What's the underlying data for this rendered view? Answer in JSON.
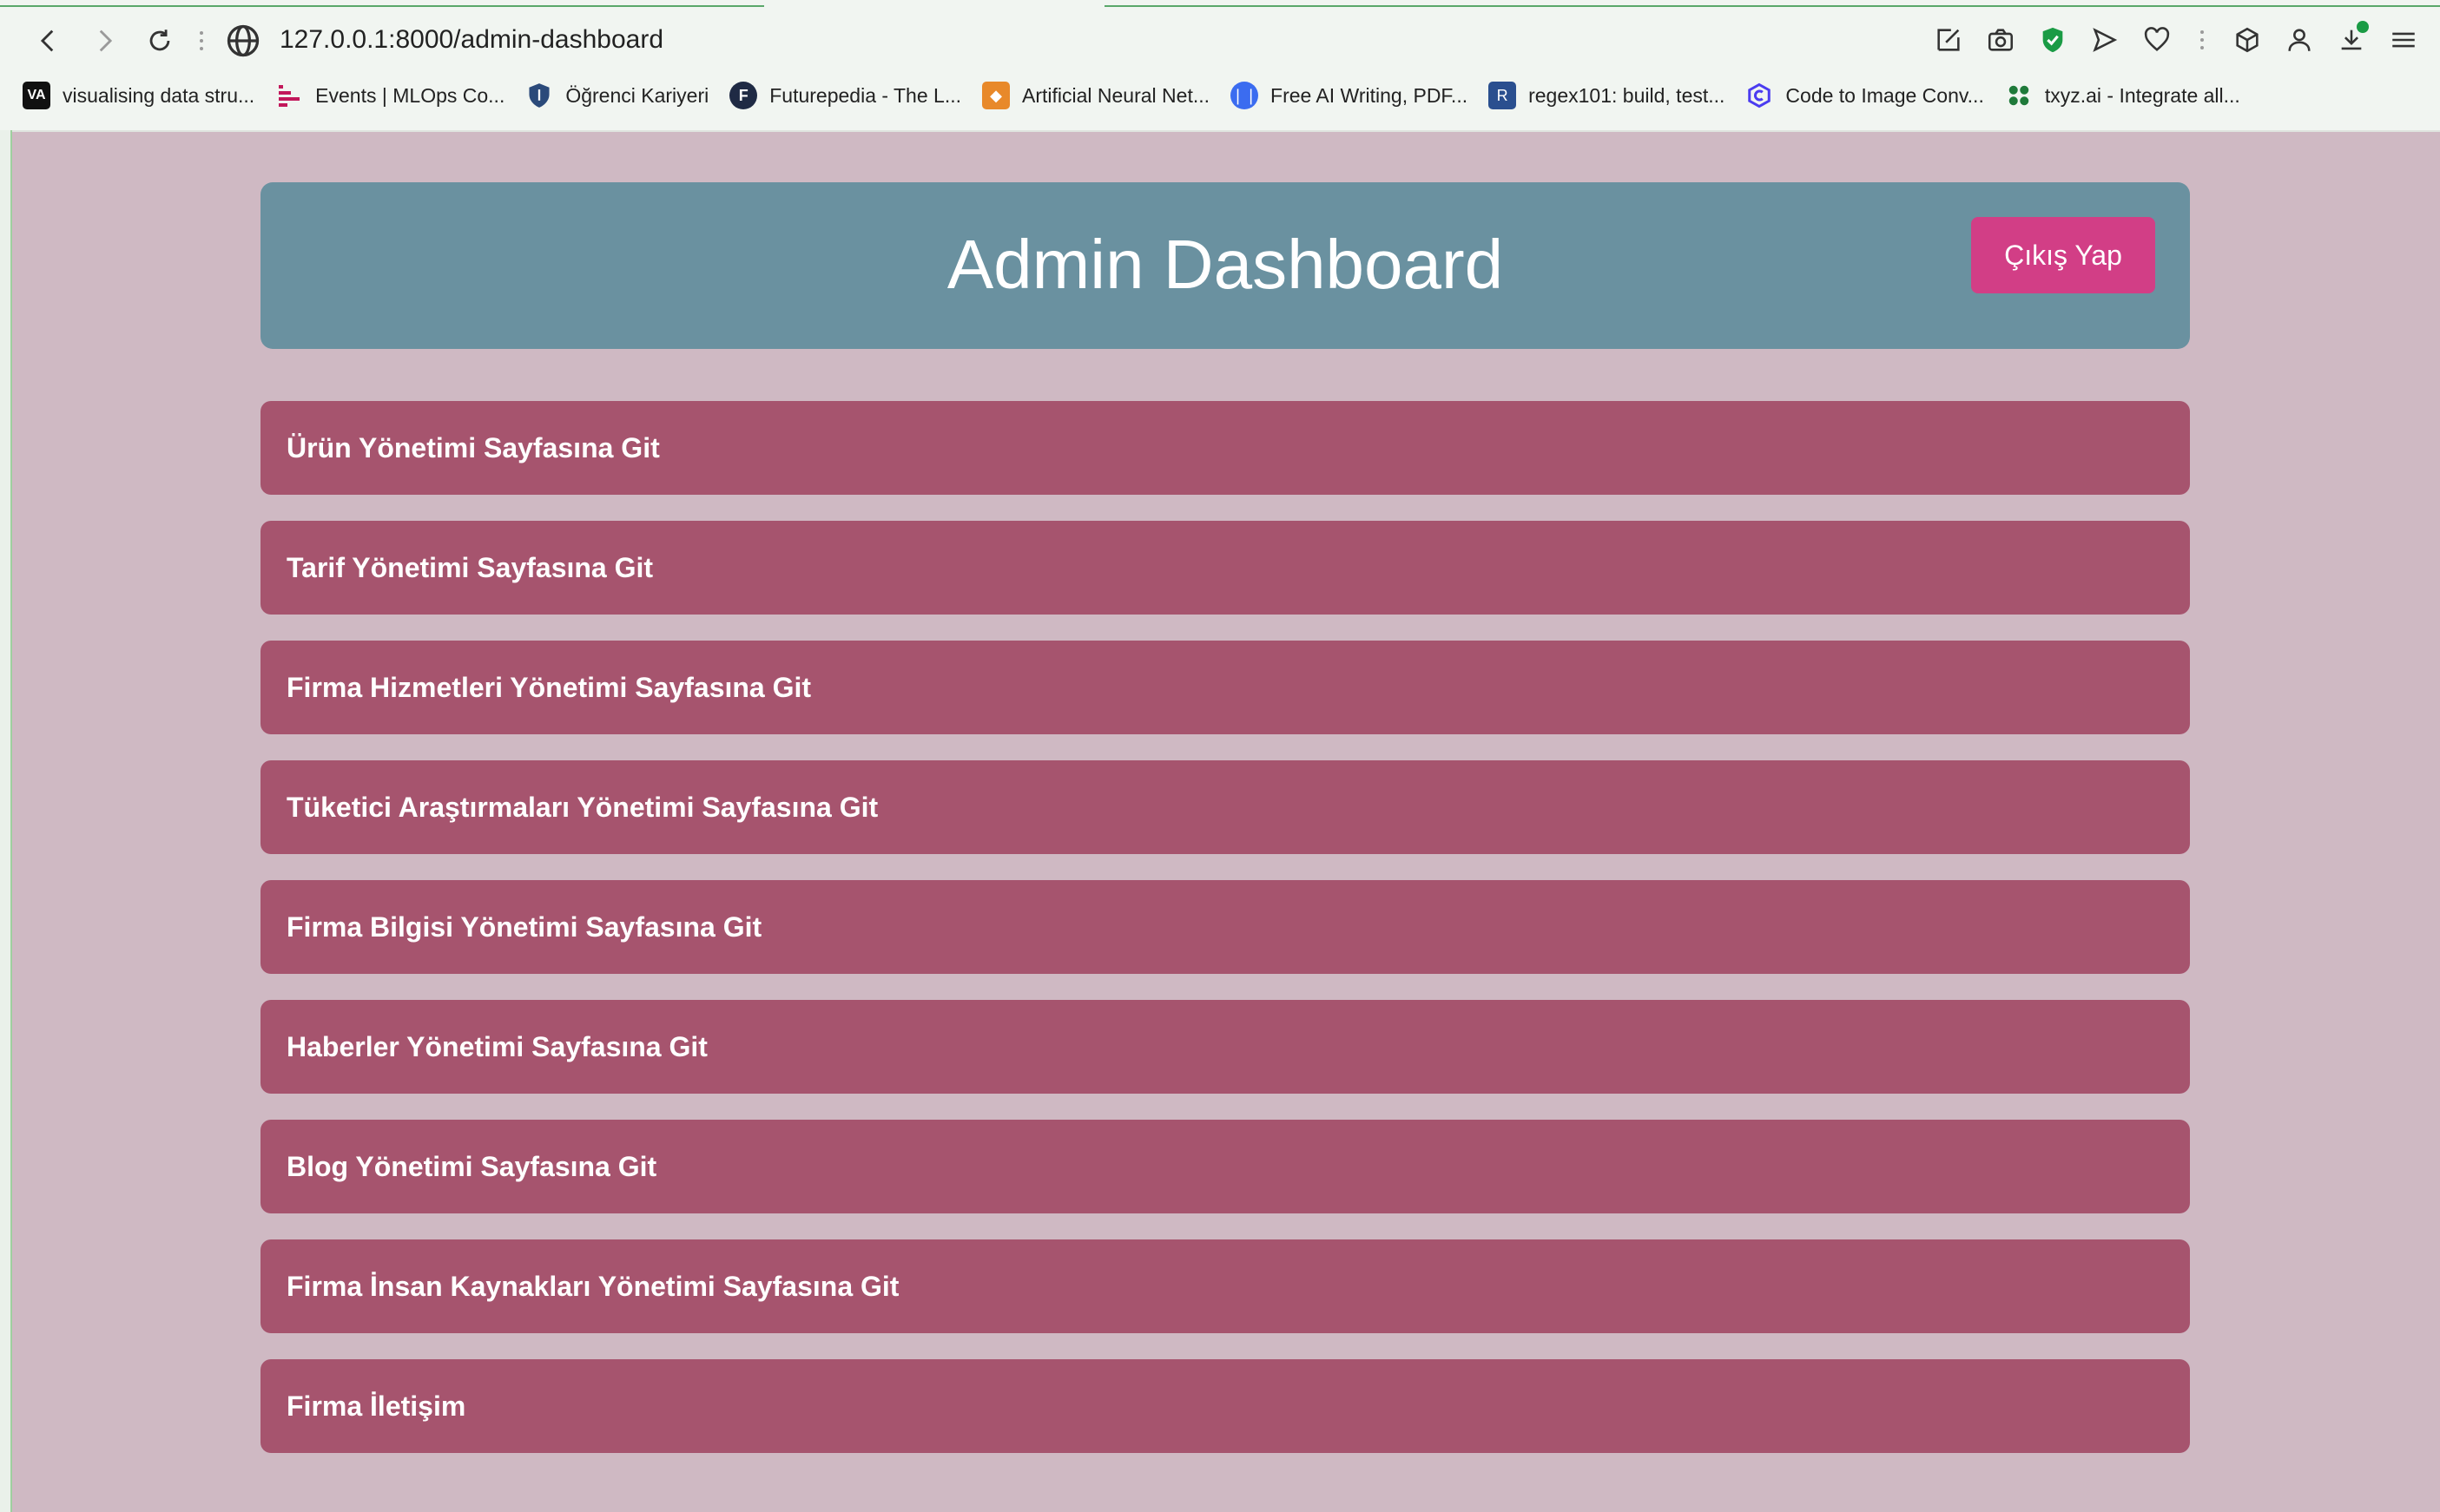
{
  "browser": {
    "url": "127.0.0.1:8000/admin-dashboard",
    "bookmarks": [
      {
        "label": "visualising data stru...",
        "icon": "va-logo-icon"
      },
      {
        "label": "Events | MLOps Co...",
        "icon": "mlops-logo-icon"
      },
      {
        "label": "Öğrenci Kariyeri",
        "icon": "shield-logo-icon"
      },
      {
        "label": "Futurepedia - The L...",
        "icon": "futurepedia-logo-icon"
      },
      {
        "label": "Artificial Neural Net...",
        "icon": "neural-net-logo-icon"
      },
      {
        "label": "Free AI Writing, PDF...",
        "icon": "ai-writing-logo-icon"
      },
      {
        "label": "regex101: build, test...",
        "icon": "regex101-logo-icon"
      },
      {
        "label": "Code to Image Conv...",
        "icon": "code-to-image-logo-icon"
      },
      {
        "label": "txyz.ai - Integrate all...",
        "icon": "txyz-logo-icon"
      }
    ]
  },
  "header": {
    "title": "Admin Dashboard",
    "logout_label": "Çıkış Yap"
  },
  "menu": [
    {
      "label": "Ürün Yönetimi Sayfasına Git"
    },
    {
      "label": "Tarif Yönetimi Sayfasına Git"
    },
    {
      "label": "Firma Hizmetleri Yönetimi Sayfasına Git"
    },
    {
      "label": "Tüketici Araştırmaları Yönetimi Sayfasına Git"
    },
    {
      "label": "Firma Bilgisi Yönetimi Sayfasına Git"
    },
    {
      "label": "Haberler Yönetimi Sayfasına Git"
    },
    {
      "label": "Blog Yönetimi Sayfasına Git"
    },
    {
      "label": "Firma İnsan Kaynakları Yönetimi Sayfasına Git"
    },
    {
      "label": "Firma İletişim"
    }
  ],
  "colors": {
    "page_background": "#cfb9c3",
    "header_background": "#6a91a0",
    "logout_button": "#d23e86",
    "menu_item": "#a6546e"
  }
}
